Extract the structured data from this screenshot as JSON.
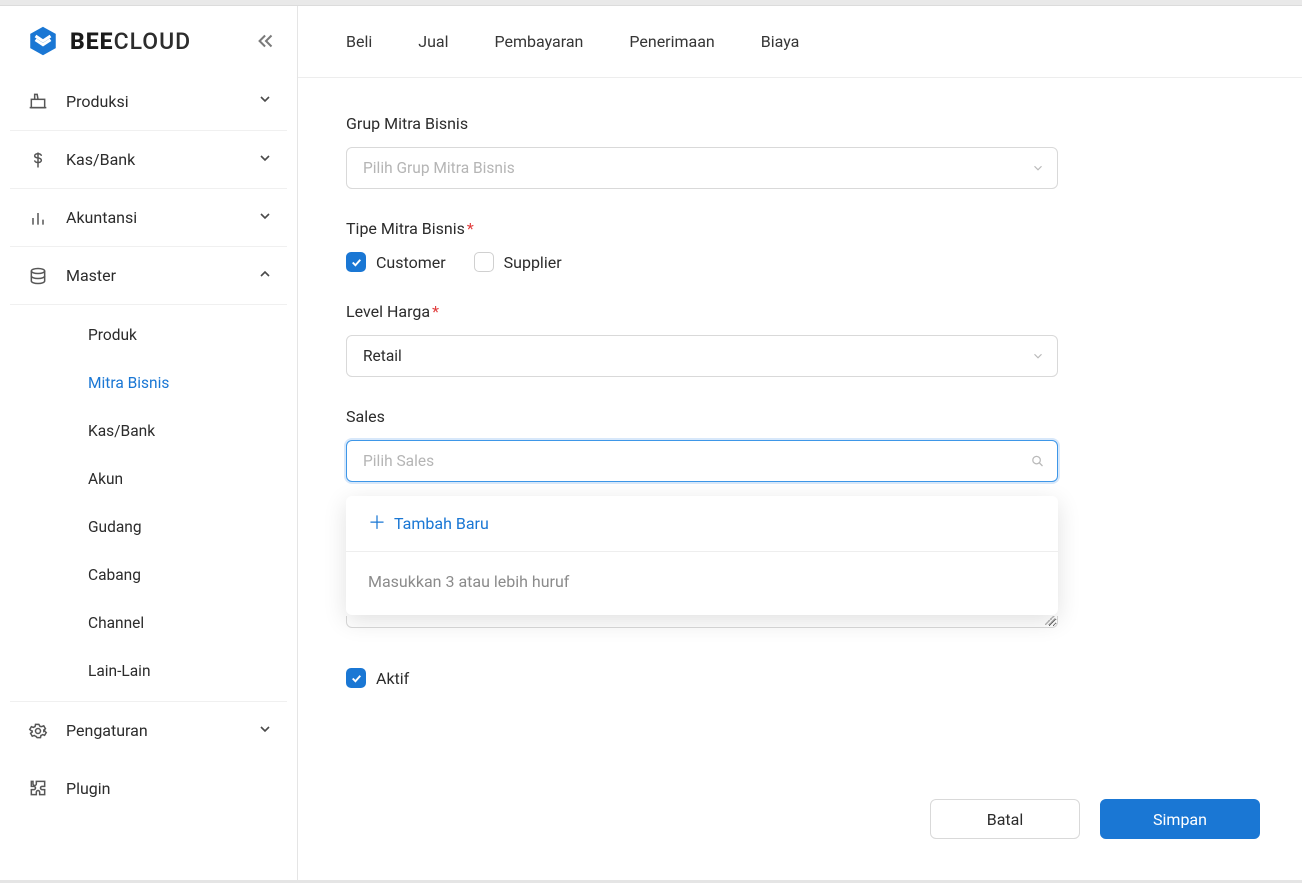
{
  "brand": {
    "bold": "BEE",
    "light": "CLOUD"
  },
  "topbar": {
    "tabs": [
      "Beli",
      "Jual",
      "Pembayaran",
      "Penerimaan",
      "Biaya"
    ]
  },
  "sidebar": {
    "items": [
      {
        "label": "Produksi",
        "expanded": false
      },
      {
        "label": "Kas/Bank",
        "expanded": false
      },
      {
        "label": "Akuntansi",
        "expanded": false
      },
      {
        "label": "Master",
        "expanded": true,
        "children": [
          "Produk",
          "Mitra Bisnis",
          "Kas/Bank",
          "Akun",
          "Gudang",
          "Cabang",
          "Channel",
          "Lain-Lain"
        ],
        "active_child": 1
      },
      {
        "label": "Pengaturan",
        "expanded": false
      },
      {
        "label": "Plugin",
        "expanded": null
      }
    ]
  },
  "form": {
    "grup": {
      "label": "Grup Mitra Bisnis",
      "placeholder": "Pilih Grup Mitra Bisnis"
    },
    "tipe": {
      "label": "Tipe Mitra Bisnis",
      "options": {
        "customer": "Customer",
        "supplier": "Supplier"
      },
      "customer_checked": true,
      "supplier_checked": false
    },
    "level": {
      "label": "Level Harga",
      "value": "Retail"
    },
    "sales": {
      "label": "Sales",
      "placeholder": "Pilih Sales"
    },
    "aktif": {
      "label": "Aktif",
      "checked": true
    }
  },
  "dropdown": {
    "add_label": "Tambah Baru",
    "hint": "Masukkan 3 atau lebih huruf"
  },
  "buttons": {
    "cancel": "Batal",
    "save": "Simpan"
  }
}
